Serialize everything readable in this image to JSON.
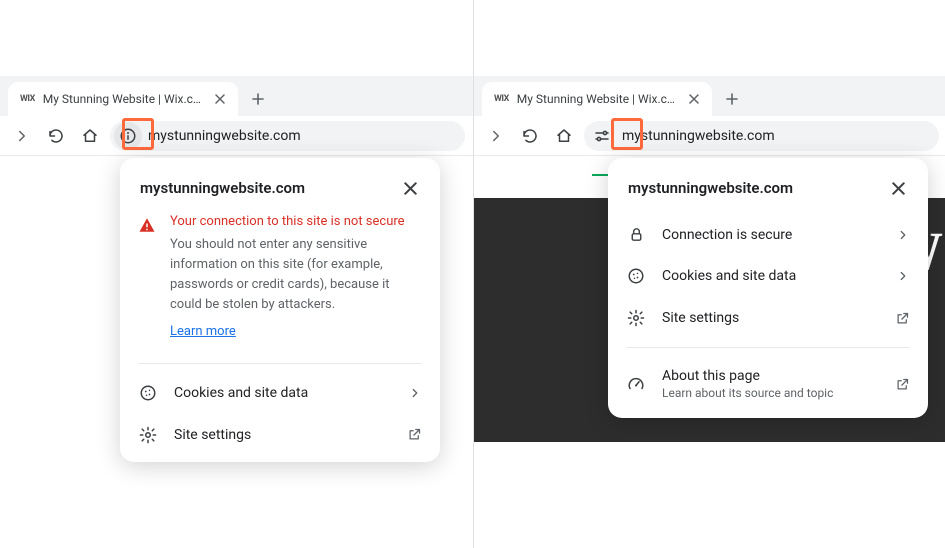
{
  "left": {
    "tab": {
      "favicon": "WIX",
      "title": "My Stunning Website | Wix.com"
    },
    "omnibox": "mystunningwebsite.com",
    "popup": {
      "title": "mystunningwebsite.com",
      "warning_title": "Your connection to this site is not secure",
      "warning_body": "You should not enter any sensitive information on this site (for example, passwords or credit cards), because it could be stolen by attackers.",
      "learn_more": "Learn more",
      "cookies_label": "Cookies and site data",
      "settings_label": "Site settings"
    }
  },
  "right": {
    "tab": {
      "favicon": "WIX",
      "title": "My Stunning Website | Wix.com"
    },
    "omnibox": "mystunningwebsite.com",
    "popup": {
      "title": "mystunningwebsite.com",
      "secure_label": "Connection is secure",
      "cookies_label": "Cookies and site data",
      "settings_label": "Site settings",
      "about_label": "About this page",
      "about_sub": "Learn about its source and topic"
    },
    "page_letter": "W"
  }
}
